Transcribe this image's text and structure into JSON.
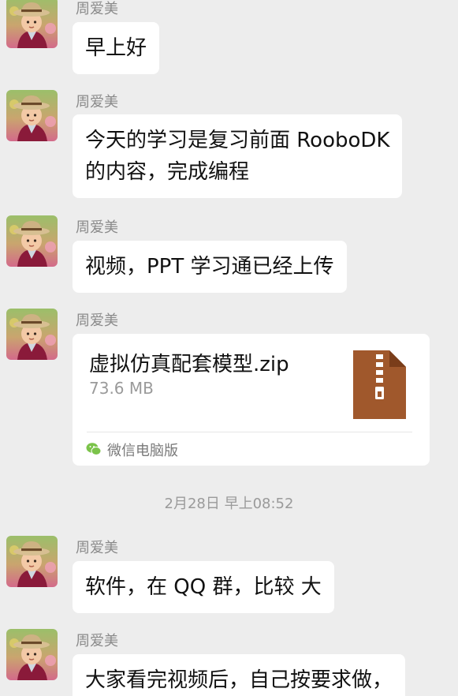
{
  "sender_name": "周爱美",
  "messages": [
    {
      "text": "早上好"
    },
    {
      "line1": "今天的学习是复习前面 RooboDK",
      "line2": "的内容，完成编程"
    },
    {
      "text": "视频，PPT 学习通已经上传"
    },
    {
      "file_name": "虚拟仿真配套模型.zip",
      "file_size": "73.6 MB",
      "source": "微信电脑版"
    },
    {
      "text": "软件，在 QQ 群，比较 大"
    },
    {
      "text": "大家看完视频后，自己按要求做，"
    }
  ],
  "timestamp": "2月28日 早上08:52",
  "icons": {
    "avatar": "child-photo-avatar",
    "file": "zip-file-icon",
    "source": "wechat-icon"
  },
  "colors": {
    "background": "#ededed",
    "bubble": "#ffffff",
    "zip_icon": "#a0582c",
    "wechat": "#7bc34a"
  }
}
